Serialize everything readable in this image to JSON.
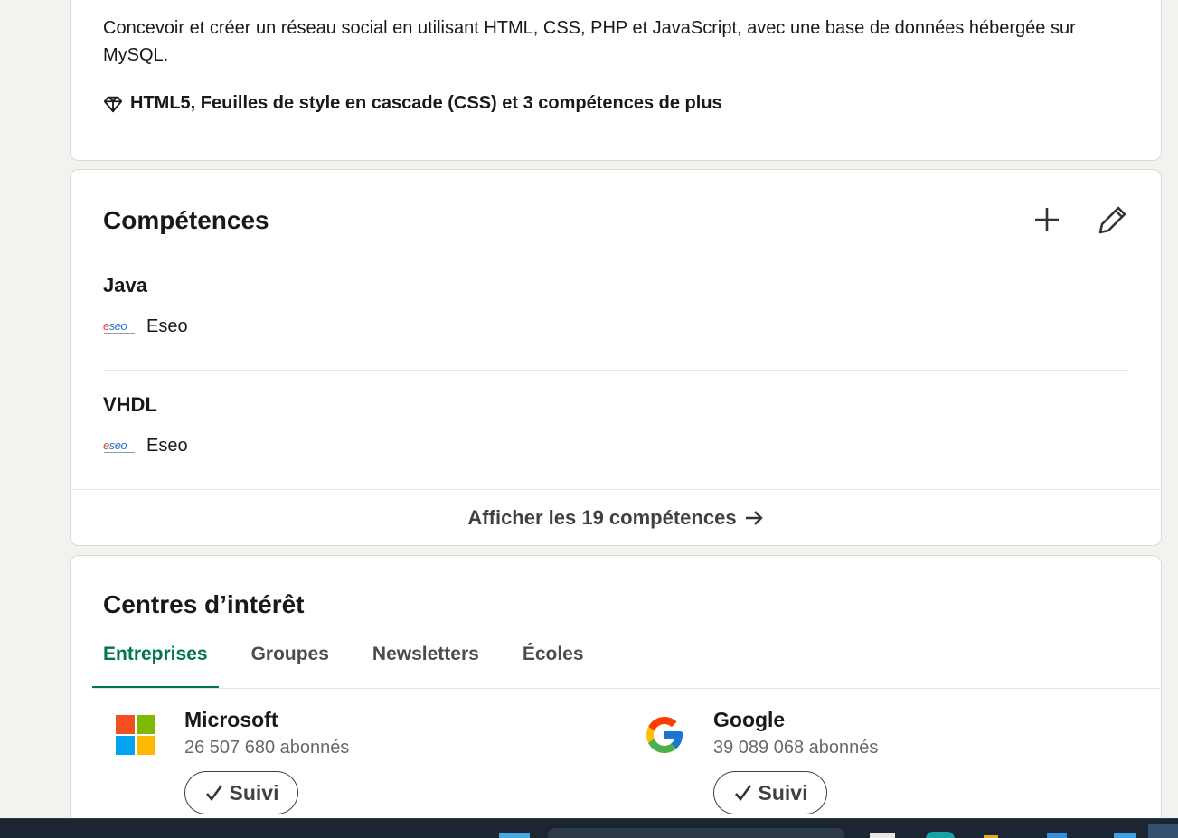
{
  "project": {
    "description": "Concevoir et créer un réseau social en utilisant HTML, CSS, PHP et JavaScript, avec une base de données hébergée sur MySQL.",
    "skills_summary": "HTML5, Feuilles de style en cascade (CSS) et 3 compétences de plus",
    "skills_icon": "diamond-icon"
  },
  "skills": {
    "title": "Compétences",
    "add_icon": "plus-icon",
    "edit_icon": "pencil-icon",
    "items": [
      {
        "name": "Java",
        "source": "Eseo",
        "source_logo": "eseo"
      },
      {
        "name": "VHDL",
        "source": "Eseo",
        "source_logo": "eseo"
      }
    ],
    "show_all_label": "Afficher les 19 compétences",
    "show_all_icon": "arrow-right-icon"
  },
  "interests": {
    "title": "Centres d’intérêt",
    "tabs": [
      {
        "label": "Entreprises",
        "active": true
      },
      {
        "label": "Groupes",
        "active": false
      },
      {
        "label": "Newsletters",
        "active": false
      },
      {
        "label": "Écoles",
        "active": false
      }
    ],
    "companies": [
      {
        "name": "Microsoft",
        "followers": "26 507 680 abonnés",
        "follow_label": "Suivi",
        "logo": "microsoft-logo"
      },
      {
        "name": "Google",
        "followers": "39 089 068 abonnés",
        "follow_label": "Suivi",
        "logo": "google-logo"
      }
    ]
  },
  "colors": {
    "accent_green": "#01754f",
    "page_background": "#f4f2ee",
    "card_background": "#ffffff",
    "taskbar": "#1c2633"
  }
}
